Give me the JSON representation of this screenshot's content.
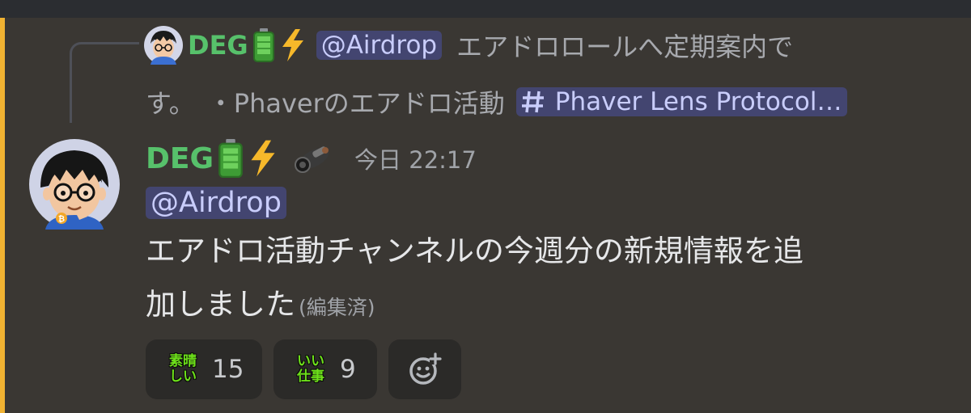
{
  "reply": {
    "author": "DEG",
    "mention": "@Airdrop",
    "text_line1": "エアドロロールへ定期案内で",
    "text_line2": "す。　・Phaverのエアドロ活動",
    "channel": "Phaver Lens Protocol…",
    "channel_icon": "hash-icon"
  },
  "message": {
    "author": "DEG",
    "timestamp": "今日 22:17",
    "mention": "@Airdrop",
    "body_line1": "エアドロ活動チャンネルの今週分の新規情報を追",
    "body_line2": "加しました",
    "edited_label": "(編集済)"
  },
  "reactions": [
    {
      "emoji_top": "素晴",
      "emoji_bottom": "しい",
      "count": "15"
    },
    {
      "emoji_top": "いい",
      "emoji_bottom": "仕事",
      "count": "9"
    }
  ],
  "icons": {
    "author_badges": [
      "battery-icon",
      "lightning-icon"
    ],
    "extra_badge": "camera-badge-icon",
    "add_reaction": "add-reaction-icon"
  },
  "colors": {
    "author_name": "#57c16b",
    "mention_bg": "#4a4b73",
    "highlight_bar": "#f0b232",
    "reaction_emoji": "#6de01a"
  }
}
